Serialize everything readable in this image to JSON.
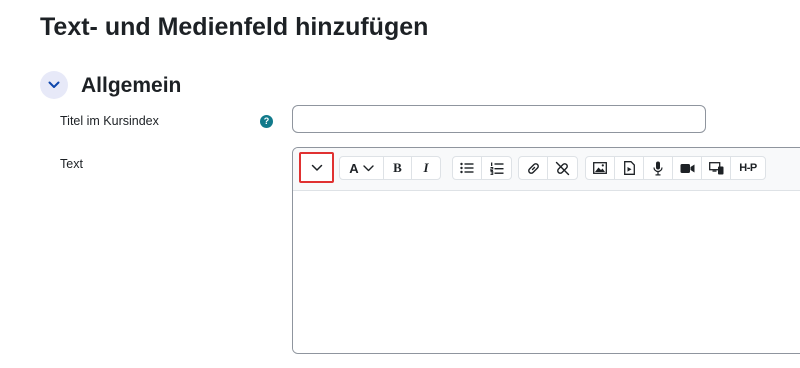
{
  "page": {
    "title": "Text- und Medienfeld hinzufügen"
  },
  "section": {
    "title": "Allgemein",
    "toggle_icon": "chevron-down-icon"
  },
  "fields": {
    "title_label": "Titel im Kursindex",
    "title_value": "",
    "help_icon_glyph": "?",
    "text_label": "Text"
  },
  "toolbar": {
    "toggle_icon": "chevron-down-icon",
    "font_icon": "A",
    "bold_label": "B",
    "italic_label": "I",
    "h5p_label": "H‑P",
    "buttons": [
      "toggle-toolbar",
      "font-style",
      "bold",
      "italic",
      "bullet-list",
      "numbered-list",
      "link",
      "unlink",
      "image",
      "media",
      "audio",
      "video",
      "screen-recorder",
      "h5p"
    ]
  },
  "colors": {
    "highlight": "#e03131",
    "section_toggle_bg": "#e7e9f8",
    "help_icon": "#117a8b"
  }
}
